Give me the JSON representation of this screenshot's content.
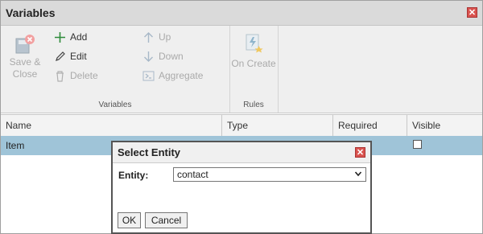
{
  "window": {
    "title": "Variables",
    "close_icon": "close-icon"
  },
  "ribbon": {
    "groups": [
      {
        "label": "Variables"
      },
      {
        "label": "Rules"
      }
    ],
    "save_close": {
      "line1": "Save &",
      "line2": "Close"
    },
    "add": "Add",
    "edit": "Edit",
    "delete": "Delete",
    "up": "Up",
    "down": "Down",
    "aggregate": "Aggregate",
    "on_create": "On Create"
  },
  "grid": {
    "columns": [
      "Name",
      "Type",
      "Required",
      "Visible"
    ],
    "rows": [
      {
        "name": "Item",
        "visible": false
      }
    ],
    "selected_row_color": "#9fc4d8"
  },
  "dialog": {
    "title": "Select Entity",
    "field_label": "Entity:",
    "selected_value": "contact",
    "ok": "OK",
    "cancel": "Cancel"
  },
  "colors": {
    "close_red": "#d9534f",
    "disabled_text": "#aaaaaa"
  }
}
